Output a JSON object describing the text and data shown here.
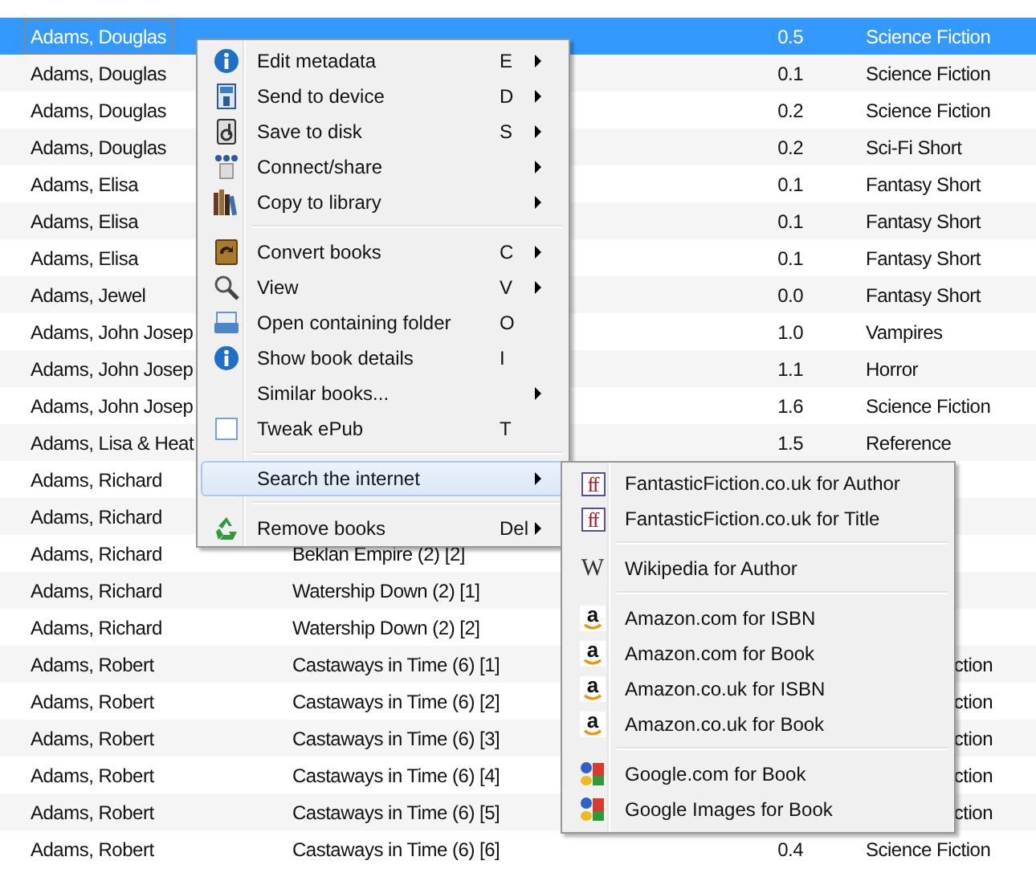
{
  "table": {
    "rows": [
      {
        "author": "Adams, Douglas",
        "rating": "0.5",
        "genre": "Science Fiction",
        "genre_partly_hidden": false,
        "selected": true
      },
      {
        "author": "Adams, Douglas",
        "rating": "0.1",
        "genre": "Science Fiction",
        "genre_partly_hidden": false,
        "selected": false
      },
      {
        "author": "Adams, Douglas",
        "rating": "0.2",
        "genre": "Science Fiction",
        "genre_partly_hidden": false,
        "selected": false
      },
      {
        "author": "Adams, Douglas",
        "rating": "0.2",
        "genre": "Sci-Fi Short",
        "genre_partly_hidden": false,
        "selected": false
      },
      {
        "author": "Adams, Elisa",
        "rating": "0.1",
        "genre": "Fantasy Short",
        "genre_partly_hidden": false,
        "selected": false
      },
      {
        "author": "Adams, Elisa",
        "rating": "0.1",
        "genre": "Fantasy Short",
        "genre_partly_hidden": false,
        "selected": false
      },
      {
        "author": "Adams, Elisa",
        "rating": "0.1",
        "genre": "Fantasy Short",
        "genre_partly_hidden": false,
        "selected": false
      },
      {
        "author": "Adams, Jewel",
        "rating": "0.0",
        "genre": "Fantasy Short",
        "genre_partly_hidden": false,
        "selected": false
      },
      {
        "author": "Adams, John Josep",
        "rating": "1.0",
        "genre": "Vampires",
        "genre_partly_hidden": false,
        "selected": false
      },
      {
        "author": "Adams, John Josep",
        "rating": "1.1",
        "genre": "Horror",
        "genre_partly_hidden": false,
        "selected": false
      },
      {
        "author": "Adams, John Josep",
        "rating": "1.6",
        "genre": "Science Fiction",
        "genre_partly_hidden": false,
        "selected": false
      },
      {
        "author": "Adams, Lisa & Heat",
        "rating": "1.5",
        "genre": "Reference",
        "genre_partly_hidden": false,
        "selected": false
      },
      {
        "author": "Adams, Richard",
        "genre_partly_hidden": false,
        "selected": false
      },
      {
        "author": "Adams, Richard",
        "genre_partly_hidden": false,
        "selected": false
      },
      {
        "author": "Adams, Richard",
        "title": "Beklan Empire (2) [2]",
        "genre_partly_hidden": false,
        "selected": false
      },
      {
        "author": "Adams, Richard",
        "title": "Watership Down (2) [1]",
        "genre_partly_hidden": false,
        "selected": false
      },
      {
        "author": "Adams, Richard",
        "title": "Watership Down (2) [2]",
        "genre_partly_hidden": false,
        "selected": false
      },
      {
        "author": "Adams, Robert",
        "title": "Castaways in Time (6) [1]",
        "genre": "ction",
        "genre_partly_hidden": true,
        "selected": false
      },
      {
        "author": "Adams, Robert",
        "title": "Castaways in Time (6) [2]",
        "genre": "ction",
        "genre_partly_hidden": true,
        "selected": false
      },
      {
        "author": "Adams, Robert",
        "title": "Castaways in Time (6) [3]",
        "genre": "ction",
        "genre_partly_hidden": true,
        "selected": false
      },
      {
        "author": "Adams, Robert",
        "title": "Castaways in Time (6) [4]",
        "genre": "ction",
        "genre_partly_hidden": true,
        "selected": false
      },
      {
        "author": "Adams, Robert",
        "title": "Castaways in Time (6) [5]",
        "genre": "ction",
        "genre_partly_hidden": true,
        "selected": false
      },
      {
        "author": "Adams, Robert",
        "title": "Castaways in Time (6) [6]",
        "rating": "0.4",
        "genre": "Science Fiction",
        "genre_partly_hidden": false,
        "selected": false
      }
    ]
  },
  "context_menu": {
    "items": [
      {
        "kind": "item",
        "label": "Edit metadata",
        "shortcut": "E",
        "submenu": true,
        "selected": false
      },
      {
        "kind": "item",
        "label": "Send to device",
        "shortcut": "D",
        "submenu": true,
        "selected": false
      },
      {
        "kind": "item",
        "label": "Save to disk",
        "shortcut": "S",
        "submenu": true,
        "selected": false
      },
      {
        "kind": "item",
        "label": "Connect/share",
        "submenu": true,
        "selected": false
      },
      {
        "kind": "item",
        "label": "Copy to library",
        "submenu": true,
        "selected": false
      },
      {
        "kind": "separator"
      },
      {
        "kind": "item",
        "label": "Convert books",
        "shortcut": "C",
        "submenu": true,
        "selected": false
      },
      {
        "kind": "item",
        "label": "View",
        "shortcut": "V",
        "submenu": true,
        "selected": false
      },
      {
        "kind": "item",
        "label": "Open containing folder",
        "shortcut": "O",
        "submenu": false,
        "selected": false
      },
      {
        "kind": "item",
        "label": "Show book details",
        "shortcut": "I",
        "submenu": false,
        "selected": false
      },
      {
        "kind": "item",
        "label": "Similar books...",
        "submenu": true,
        "selected": false
      },
      {
        "kind": "item",
        "label": "Tweak ePub",
        "shortcut": "T",
        "submenu": false,
        "selected": false
      },
      {
        "kind": "separator"
      },
      {
        "kind": "item",
        "label": "Search the internet",
        "submenu": true,
        "selected": true
      },
      {
        "kind": "separator"
      },
      {
        "kind": "item",
        "label": "Remove books",
        "shortcut": "Del",
        "submenu": true,
        "selected": false
      }
    ]
  },
  "submenu": {
    "items": [
      {
        "kind": "item",
        "label": "FantasticFiction.co.uk for Author",
        "glyph": "ff"
      },
      {
        "kind": "item",
        "label": "FantasticFiction.co.uk for Title",
        "glyph": "ff"
      },
      {
        "kind": "separator"
      },
      {
        "kind": "item",
        "label": "Wikipedia for Author",
        "glyph": "W"
      },
      {
        "kind": "separator"
      },
      {
        "kind": "item",
        "label": "Amazon.com for ISBN",
        "glyph": "a"
      },
      {
        "kind": "item",
        "label": "Amazon.com for Book",
        "glyph": "a"
      },
      {
        "kind": "item",
        "label": "Amazon.co.uk for ISBN",
        "glyph": "a"
      },
      {
        "kind": "item",
        "label": "Amazon.co.uk for Book",
        "glyph": "a"
      },
      {
        "kind": "separator"
      },
      {
        "kind": "item",
        "label": "Google.com for Book"
      },
      {
        "kind": "item",
        "label": "Google Images for Book"
      }
    ]
  }
}
